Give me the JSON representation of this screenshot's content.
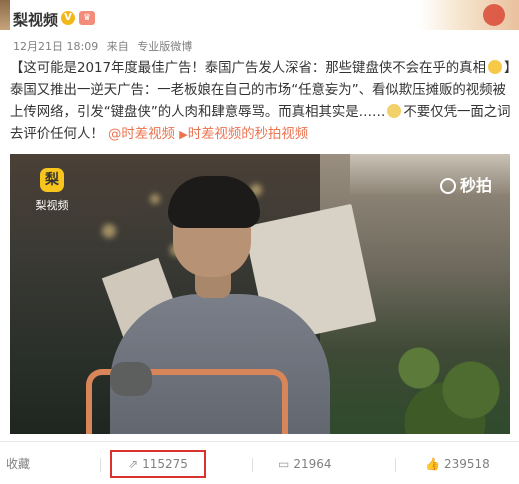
{
  "header": {
    "username": "梨视频",
    "verified_icon": "verified-icon",
    "rank_icon": "crown-icon",
    "date": "12月21日 18:09",
    "source_prefix": "来自",
    "source": "专业版微博"
  },
  "post": {
    "text_part1": "【这可能是2017年度最佳广告！泰国广告发人深省：那些键盘侠不会在乎的真相",
    "text_part2": "】泰国又推出一逆天广告：一老板娘在自己的市场“任意妄为”、看似欺压摊贩的视频被上传网络，引发“键盘侠”的人肉和肆意辱骂。而真相其实是……",
    "text_part3": "不要仅凭一面之词去评价任何人！",
    "link1": "@时差视频",
    "link2_icon": "video-link-icon",
    "link2": "时差视频的秒拍视频"
  },
  "video": {
    "logo_text": "梨视频",
    "logo_mark": "梨",
    "watermark": "秒拍"
  },
  "actions": {
    "favorite_label": "收藏",
    "forward_count": "115275",
    "comment_count": "21964",
    "like_count": "239518"
  },
  "colors": {
    "link": "#eb7350",
    "highlight_box": "#d9322e",
    "text": "#333333",
    "muted": "#808080"
  }
}
